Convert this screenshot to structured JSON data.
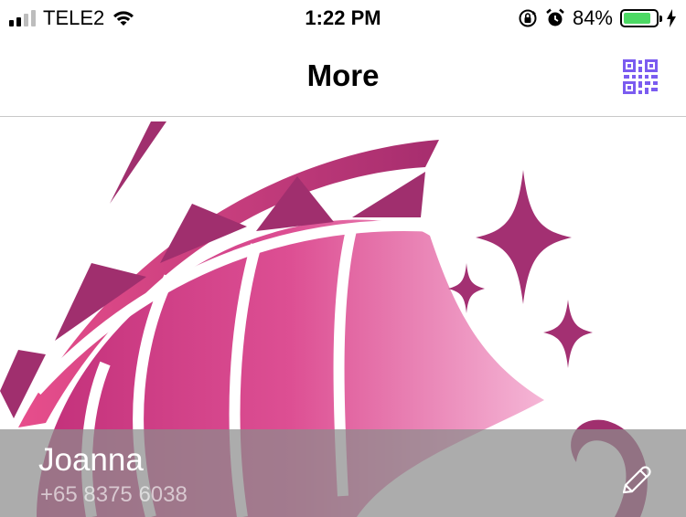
{
  "status_bar": {
    "carrier": "TELE2",
    "time": "1:22 PM",
    "battery_percent": "84%",
    "battery_level": 0.84,
    "icons": [
      "signal-icon",
      "wifi-icon",
      "orientation-lock-icon",
      "alarm-icon",
      "battery-icon",
      "charging-icon"
    ]
  },
  "nav": {
    "title": "More",
    "qr_icon": "qr-code-icon"
  },
  "profile": {
    "name": "Joanna",
    "phone": "+65 8375 6038",
    "edit_icon": "pencil-icon"
  },
  "colors": {
    "accent_qr": "#7b5cf0",
    "battery_green": "#4cd964",
    "hero_magenta": "#a03070",
    "hero_pink": "#e0569a",
    "overlay_gray": "#8c8c8c"
  }
}
